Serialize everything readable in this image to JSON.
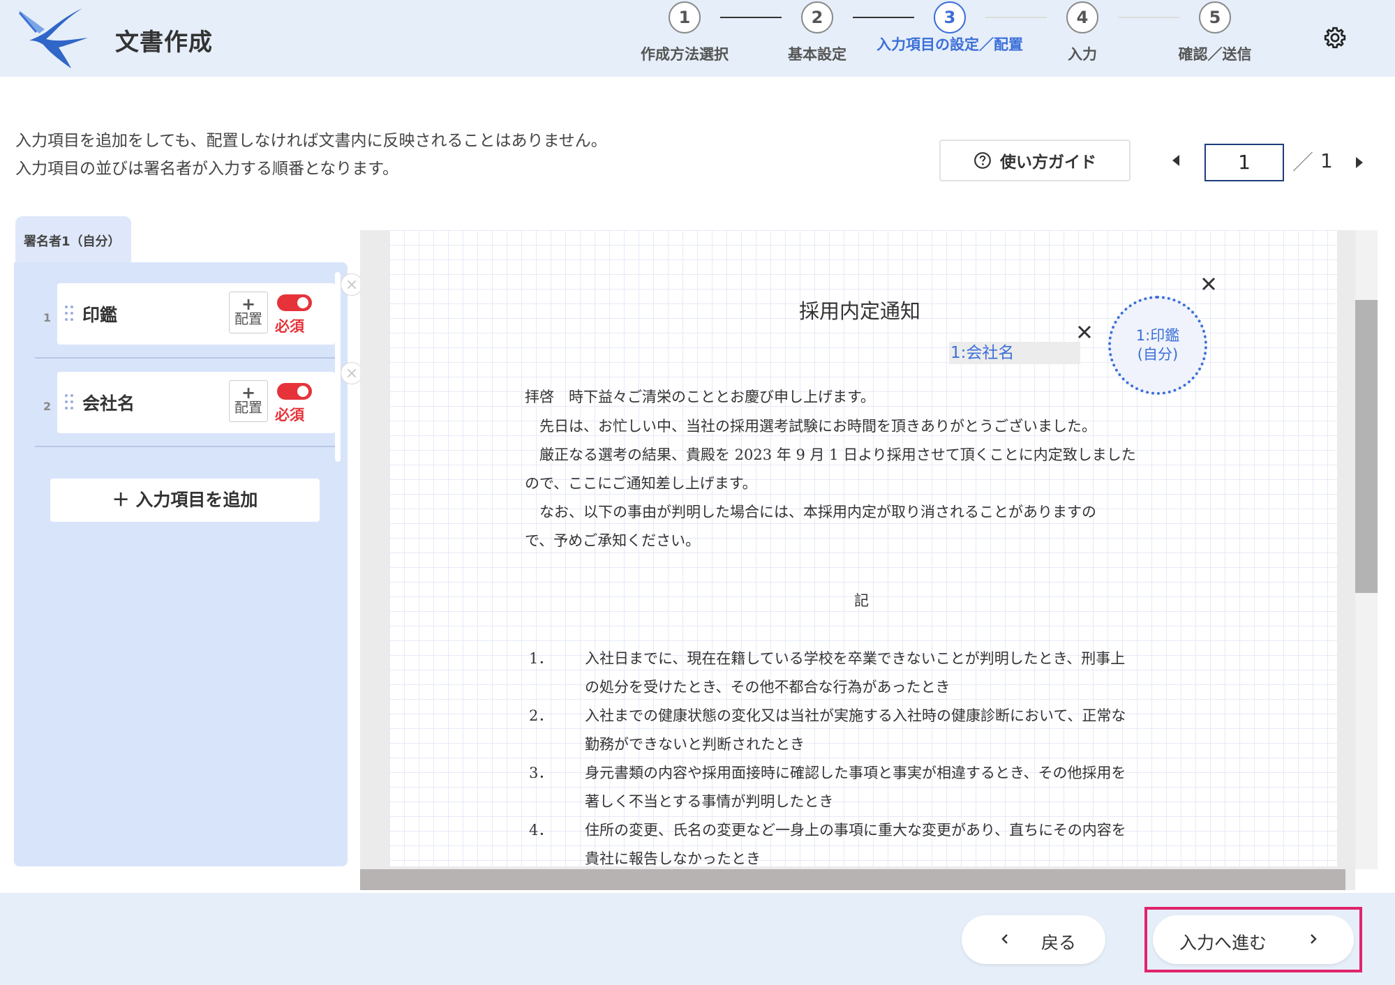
{
  "header": {
    "title": "文書作成",
    "steps": [
      {
        "number": "1",
        "label": "作成方法選択",
        "state": "done"
      },
      {
        "number": "2",
        "label": "基本設定",
        "state": "done"
      },
      {
        "number": "3",
        "label": "入力項目の設定／配置",
        "state": "active"
      },
      {
        "number": "4",
        "label": "入力",
        "state": "todo"
      },
      {
        "number": "5",
        "label": "確認／送信",
        "state": "todo"
      }
    ],
    "settings_icon": "gear-icon",
    "accent_color": "#3b6fd8"
  },
  "instructions": {
    "line1": "入力項目を追加をしても、配置しなければ文書内に反映されることはありません。",
    "line2": "入力項目の並びは署名者が入力する順番となります。"
  },
  "guide_button": {
    "label": "使い方ガイド",
    "icon": "question-circle-icon"
  },
  "pager": {
    "current": "1",
    "separator": "／",
    "total": "1"
  },
  "signer_panel": {
    "tab_label": "署名者1（自分）",
    "items": [
      {
        "number": "1",
        "label": "印鑑",
        "place_plus": "+",
        "place_label": "配置",
        "required_label": "必須",
        "required": true
      },
      {
        "number": "2",
        "label": "会社名",
        "place_plus": "+",
        "place_label": "配置",
        "required_label": "必須",
        "required": true
      }
    ],
    "add_button_label": "＋ 入力項目を追加",
    "required_color": "#e6333a"
  },
  "document": {
    "title": "採用内定通知",
    "company_field_label": "1:会社名",
    "seal_field_line1": "1:印鑑",
    "seal_field_line2": "(自分)",
    "paragraphs": [
      "拝啓　時下益々ご清栄のこととお慶び申し上げます。",
      "　先日は、お忙しい中、当社の採用選考試験にお時間を頂きありがとうございました。",
      "　厳正なる選考の結果、貴殿を 2023 年 9 月 1 日より採用させて頂くことに内定致しました",
      "ので、ここにご通知差し上げます。",
      "　なお、以下の事由が判明した場合には、本採用内定が取り消されることがありますの",
      "で、予めご承知ください。"
    ],
    "center_heading": "記",
    "list": [
      {
        "num": "1．",
        "line1": "入社日までに、現在在籍している学校を卒業できないことが判明したとき、刑事上",
        "line2": "の処分を受けたとき、その他不都合な行為があったとき"
      },
      {
        "num": "2．",
        "line1": "入社までの健康状態の変化又は当社が実施する入社時の健康診断において、正常な",
        "line2": "勤務ができないと判断されたとき"
      },
      {
        "num": "3．",
        "line1": "身元書類の内容や採用面接時に確認した事項と事実が相違するとき、その他採用を",
        "line2": "著しく不当とする事情が判明したとき"
      },
      {
        "num": "4．",
        "line1": "住所の変更、氏名の変更など一身上の事項に重大な変更があり、直ちにその内容を",
        "line2": "貴社に報告しなかったとき"
      }
    ]
  },
  "footer": {
    "back_label": "戻る",
    "next_label": "入力へ進む",
    "highlight_color": "#e0246b"
  }
}
